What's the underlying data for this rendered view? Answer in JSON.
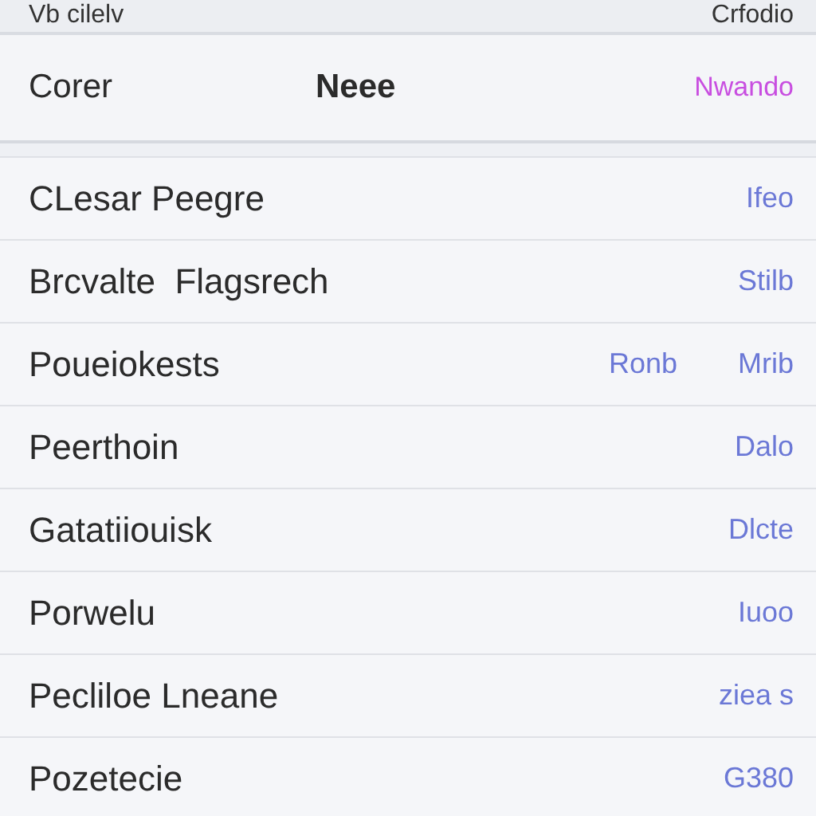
{
  "top_bar": {
    "left": "Vb cilelv",
    "right": "Crfodio"
  },
  "header": {
    "first": "Corer",
    "second": "Neee",
    "action": "Nwando"
  },
  "rows": [
    {
      "label": "CLesar Peegre",
      "value": "Ifeo"
    },
    {
      "label": "Brcvalte  Flagsrech",
      "value": "Stilb"
    },
    {
      "label": "Poueiokests",
      "detail": "Ronb",
      "value": "Mrib"
    },
    {
      "label": "Peerthoin",
      "value": "Dalo"
    },
    {
      "label": "Gatatiiouisk",
      "value": "Dlcte"
    },
    {
      "label": "Porwelu",
      "value": "Iuoo"
    },
    {
      "label": "Pecliloe Lneane",
      "value": "ziea s"
    },
    {
      "label": "Pozetecie",
      "value": "G380"
    }
  ]
}
